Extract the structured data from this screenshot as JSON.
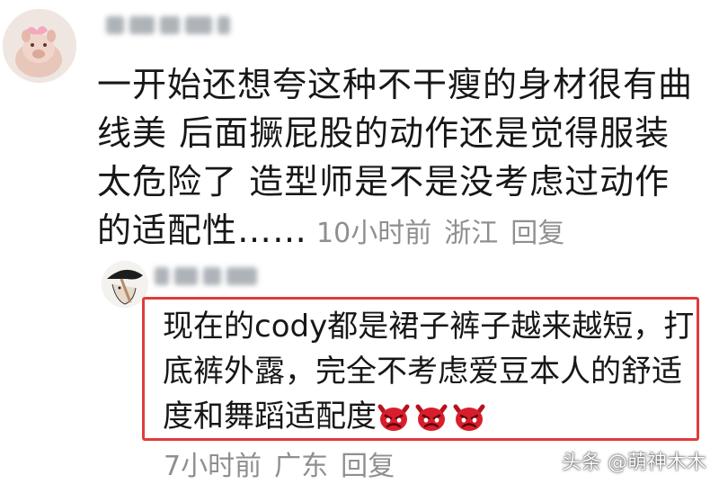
{
  "comment": {
    "text": "一开始还想夸这种不干瘦的身材很有曲线美 后面撅屁股的动作还是觉得服装太危险了 造型师是不是没考虑过动作的适配性……",
    "time": "10小时前",
    "location": "浙江",
    "reply_label": "回复"
  },
  "reply": {
    "text": "现在的cody都是裙子裤子越来越短，打底裤外露，完全不考虑爱豆本人的舒适度和舞蹈适配度",
    "emojis": [
      "angry-devil-icon",
      "angry-devil-icon",
      "angry-devil-icon"
    ],
    "time": "7小时前",
    "location": "广东",
    "reply_label": "回复"
  },
  "watermark": "头条 @萌神木木",
  "colors": {
    "highlight_border": "#e23b3b",
    "meta_text": "#8f8f8f",
    "emoji": "#d81e2c"
  }
}
